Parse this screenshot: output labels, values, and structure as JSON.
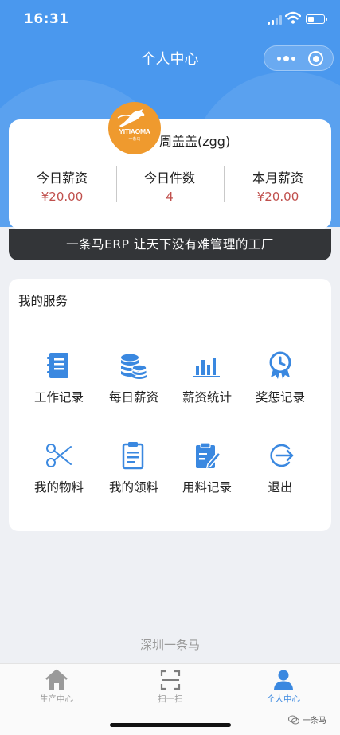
{
  "status_bar": {
    "time": "16:31"
  },
  "header": {
    "title": "个人中心"
  },
  "profile": {
    "avatar_logo": {
      "name": "YITIAOMA",
      "sub": "一条马"
    },
    "username": "周盖盖(zgg)",
    "stats": [
      {
        "label": "今日薪资",
        "value": "¥20.00"
      },
      {
        "label": "今日件数",
        "value": "4"
      },
      {
        "label": "本月薪资",
        "value": "¥20.00"
      }
    ],
    "slogan": "一条马ERP 让天下没有难管理的工厂"
  },
  "services": {
    "title": "我的服务",
    "items": [
      {
        "label": "工作记录",
        "icon": "notebook-icon"
      },
      {
        "label": "每日薪资",
        "icon": "coins-icon"
      },
      {
        "label": "薪资统计",
        "icon": "bar-chart-icon"
      },
      {
        "label": "奖惩记录",
        "icon": "award-icon"
      },
      {
        "label": "我的物料",
        "icon": "scissors-icon"
      },
      {
        "label": "我的领料",
        "icon": "clipboard-icon"
      },
      {
        "label": "用料记录",
        "icon": "edit-clipboard-icon"
      },
      {
        "label": "退出",
        "icon": "logout-icon"
      }
    ]
  },
  "footer_brand": "深圳一条马",
  "tabbar": {
    "items": [
      {
        "label": "生产中心",
        "icon": "home-icon",
        "active": false
      },
      {
        "label": "扫一扫",
        "icon": "scan-icon",
        "active": false
      },
      {
        "label": "个人中心",
        "icon": "user-icon",
        "active": true
      }
    ]
  },
  "watermark": "一条马",
  "colors": {
    "primary": "#4a98ee",
    "accent_value": "#c0504d",
    "icon_blue": "#3a88e0",
    "slogan_bg": "#333538"
  }
}
